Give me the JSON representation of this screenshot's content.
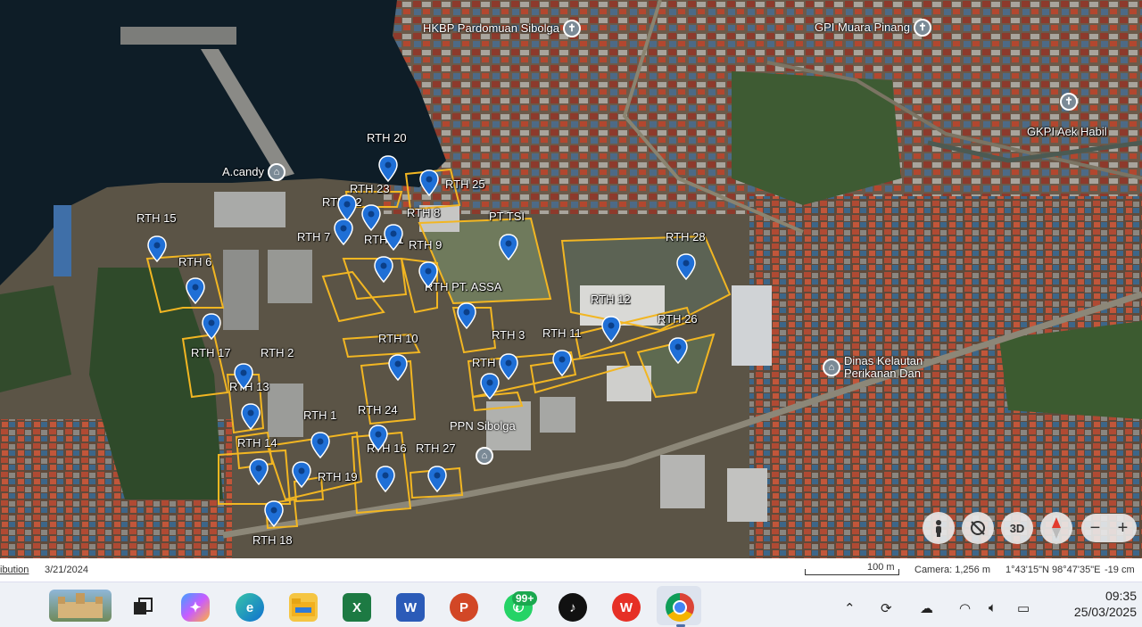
{
  "map": {
    "rth_labels": [
      "RTH 20",
      "RTH 23",
      "RTH 25",
      "RTH 22",
      "RTH 8",
      "RTH 15",
      "RTH 7",
      "RTH 21",
      "RTH 9",
      "RTH 6",
      "RTH PT. ASSA",
      "RTH 28",
      "RTH 12",
      "RTH 26",
      "RTH 10",
      "RTH 3",
      "RTH 11",
      "RTH 17",
      "RTH 2",
      "RTH 4",
      "RTH 13",
      "RTH 1",
      "RTH 24",
      "RTH 14",
      "RTH 16",
      "RTH 27",
      "RTH 19",
      "RTH 18",
      "PT TSI"
    ],
    "places": [
      {
        "name": "HKBP Pardomuan Sibolga",
        "icon": "church-icon"
      },
      {
        "name": "GPI Muara Pinang",
        "icon": "church-icon"
      },
      {
        "name": "GKPI Aek Habil",
        "icon": "church-icon"
      },
      {
        "name": "A.candy",
        "icon": "bank-icon"
      },
      {
        "name": "Dinas Kelautan Perikanan Dan",
        "icon": "building-icon"
      },
      {
        "name": "PPN Sibolga",
        "icon": "building-icon"
      }
    ],
    "controls": {
      "pegman": "pegman-icon",
      "rotate": "rotate-icon",
      "threed": "3D",
      "compass": "compass-icon",
      "zoom_out": "−",
      "zoom_in": "+"
    }
  },
  "statusbar": {
    "attribution": "ibution",
    "date": "3/21/2024",
    "scale": "100 m",
    "camera": "Camera: 1,256 m",
    "coords": "1°43'15\"N 98°47'35\"E",
    "elevation": "-19 cm"
  },
  "taskbar": {
    "apps": [
      "castle-thumbnail",
      "task-view",
      "copilot",
      "edge",
      "file-explorer",
      "excel",
      "word",
      "powerpoint",
      "whatsapp",
      "tiktok",
      "wps",
      "chrome"
    ],
    "whatsapp_badge": "99+",
    "time": "09:35",
    "date": "25/03/2025"
  },
  "colors": {
    "sea": "#0e1d27",
    "boundary": "#f2b622",
    "pin": "#1f6fd6"
  }
}
